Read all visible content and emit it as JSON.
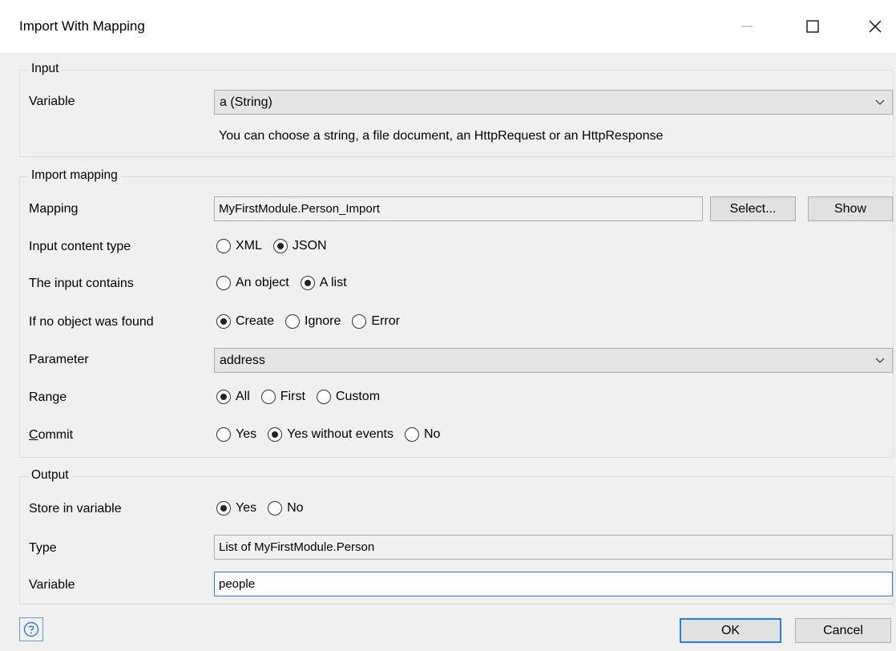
{
  "window": {
    "title": "Import With Mapping"
  },
  "input": {
    "group_label": "Input",
    "variable_label": "Variable",
    "variable_value": "a (String)",
    "hint": "You can choose a string, a file document, an HttpRequest or an HttpResponse"
  },
  "mapping": {
    "group_label": "Import mapping",
    "mapping_label": "Mapping",
    "mapping_value": "MyFirstModule.Person_Import",
    "select_button": "Select...",
    "show_button": "Show",
    "content_type_label": "Input content type",
    "content_type_options": [
      "XML",
      "JSON"
    ],
    "contains_label": "The input contains",
    "contains_options": [
      "An object",
      "A list"
    ],
    "not_found_label": "If no object was found",
    "not_found_options": [
      "Create",
      "Ignore",
      "Error"
    ],
    "parameter_label": "Parameter",
    "parameter_value": "address",
    "range_label": "Range",
    "range_options": [
      "All",
      "First",
      "Custom"
    ],
    "commit_label_first": "C",
    "commit_label_rest": "ommit",
    "commit_options": [
      "Yes",
      "Yes without events",
      "No"
    ]
  },
  "output": {
    "group_label": "Output",
    "store_label": "Store in variable",
    "store_options": [
      "Yes",
      "No"
    ],
    "type_label": "Type",
    "type_value": "List of MyFirstModule.Person",
    "variable_label": "Variable",
    "variable_value": "people"
  },
  "footer": {
    "ok_button": "OK",
    "cancel_button": "Cancel"
  },
  "selected": {
    "content_type": "JSON",
    "contains": "A list",
    "not_found": "Create",
    "range": "All",
    "commit": "Yes without events",
    "store": "Yes"
  },
  "icons": {
    "help": "help-icon",
    "minimize": "minimize-icon",
    "maximize": "maximize-icon",
    "close": "close-icon",
    "dropdown": "chevron-down-icon"
  }
}
